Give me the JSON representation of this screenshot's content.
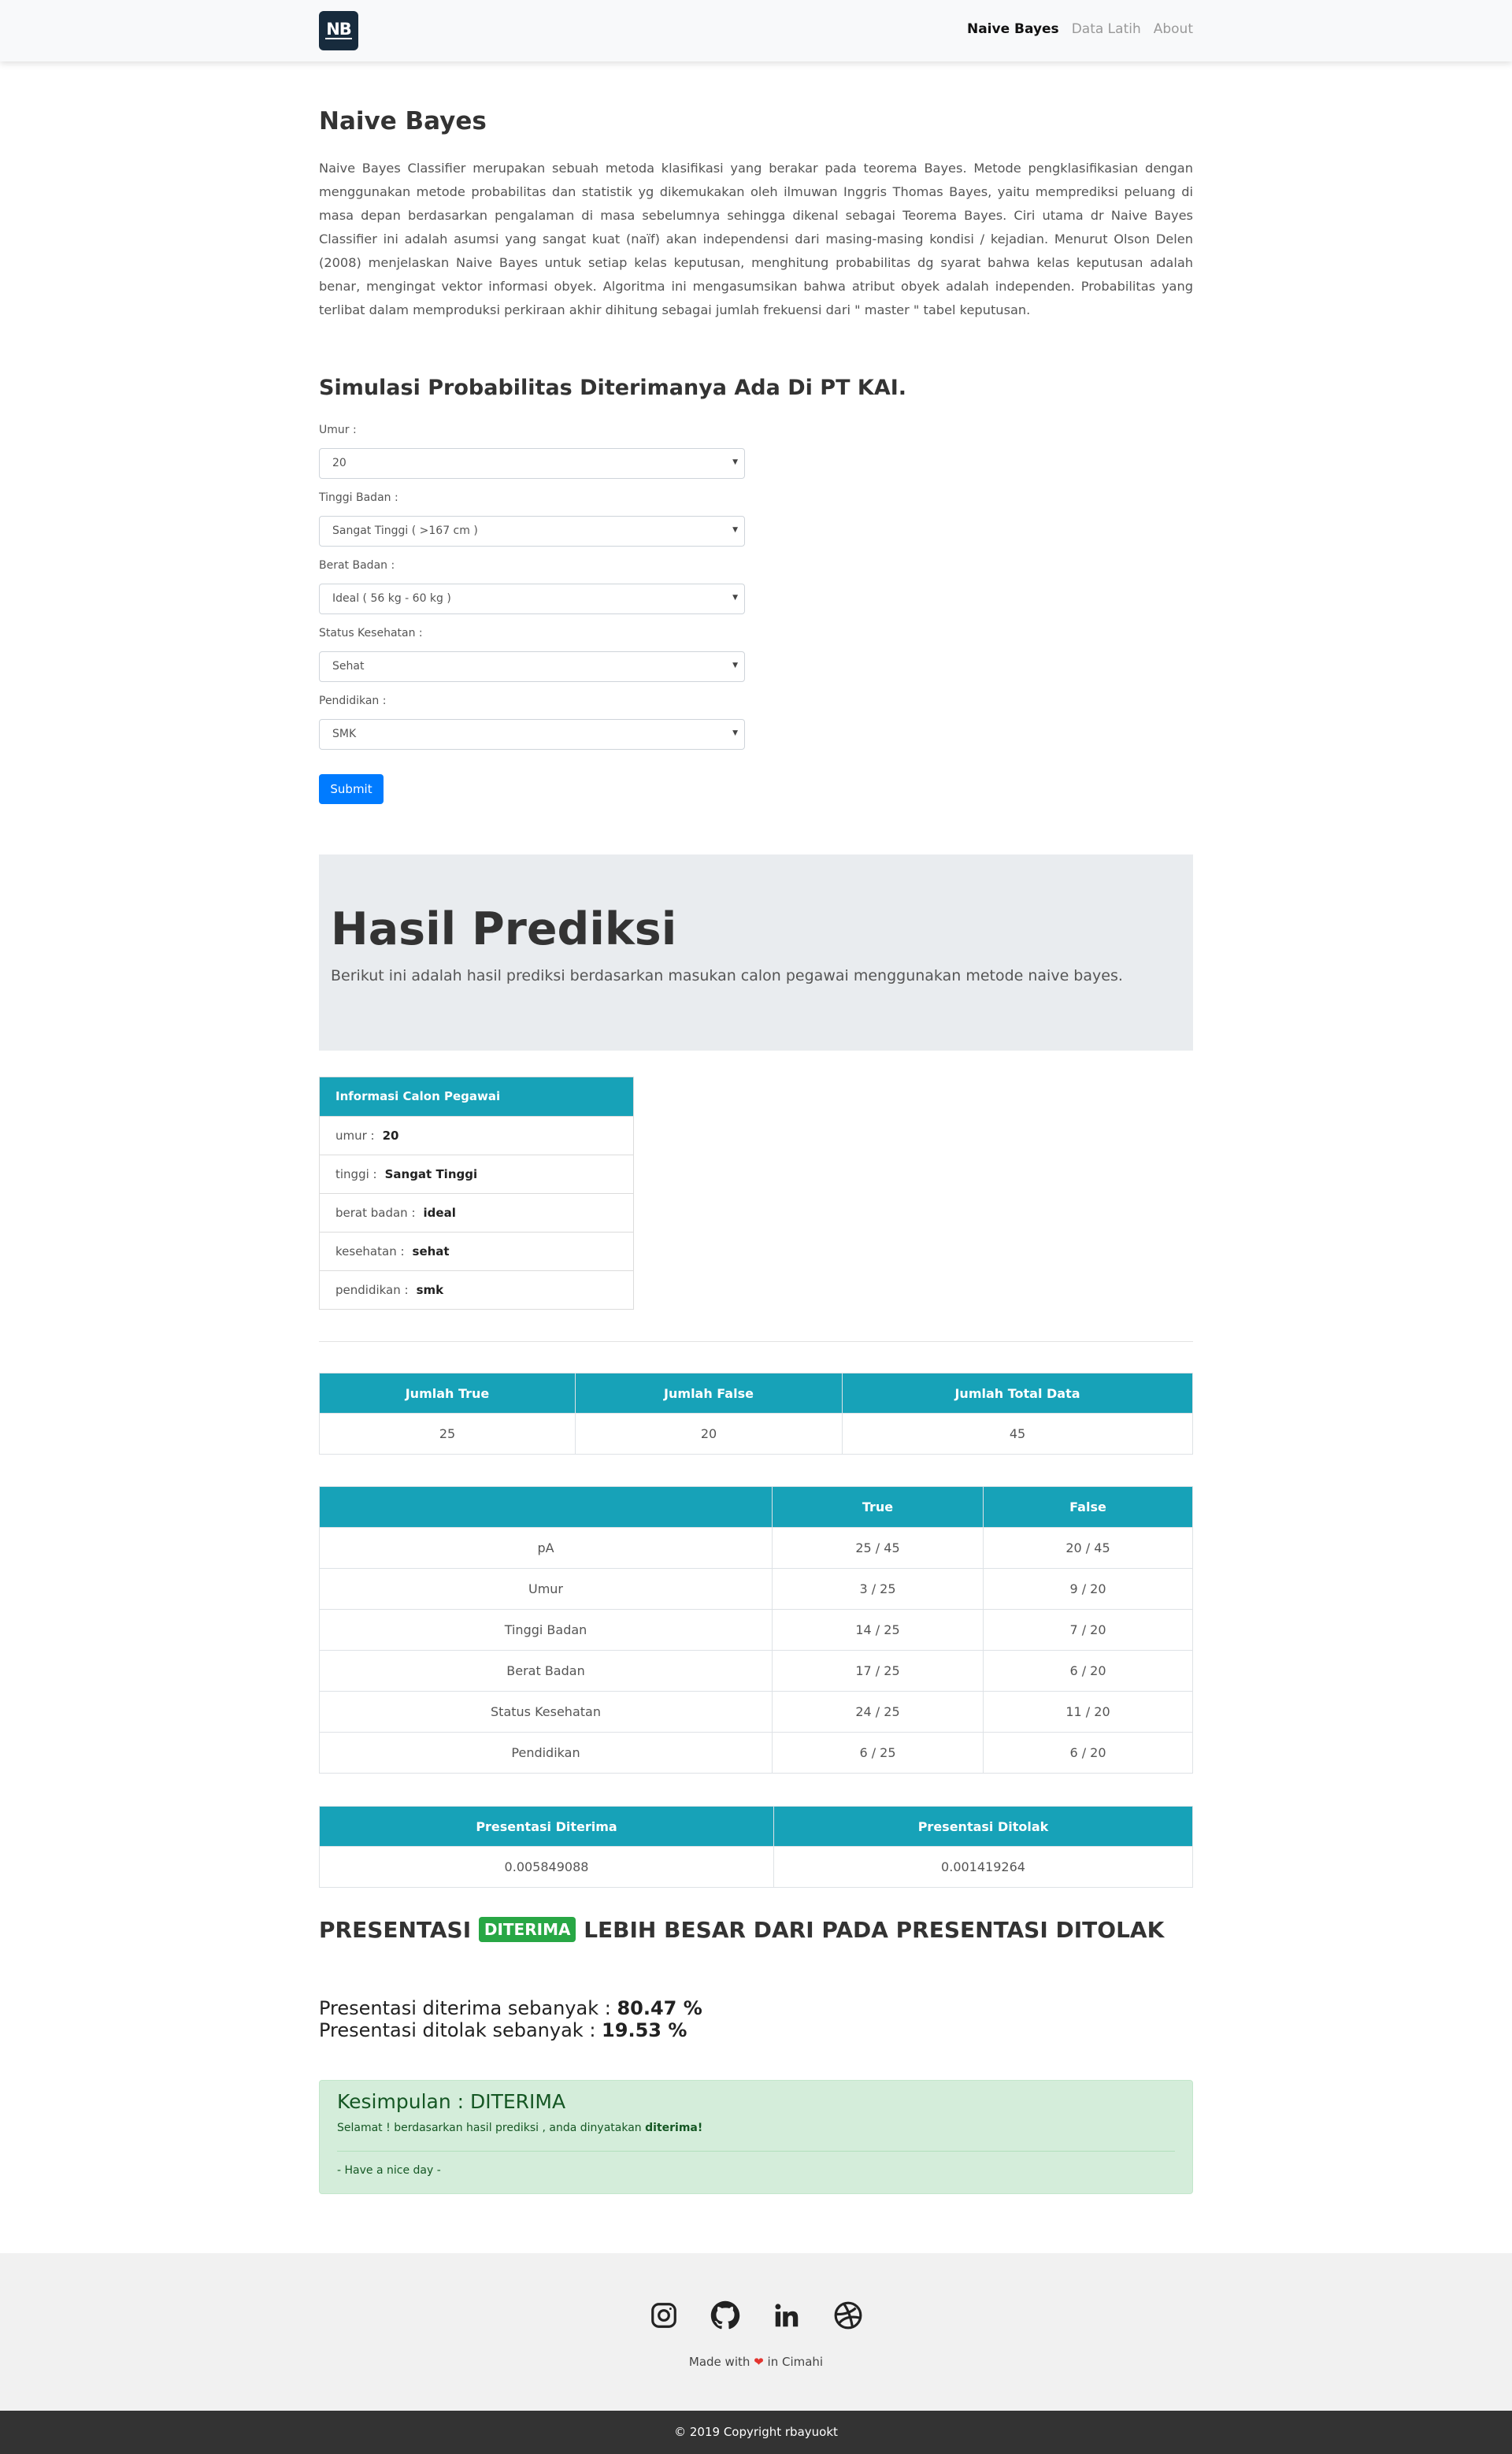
{
  "nav": {
    "brand": "NB",
    "links": [
      {
        "label": "Naive Bayes",
        "active": true
      },
      {
        "label": "Data Latih",
        "active": false
      },
      {
        "label": "About",
        "active": false
      }
    ]
  },
  "intro": {
    "title": "Naive Bayes",
    "paragraph": "Naive Bayes Classifier merupakan sebuah metoda klasifikasi yang berakar pada teorema Bayes. Metode pengklasifikasian dengan menggunakan metode probabilitas dan statistik yg dikemukakan oleh ilmuwan Inggris Thomas Bayes, yaitu memprediksi peluang di masa depan berdasarkan pengalaman di masa sebelumnya sehingga dikenal sebagai Teorema Bayes. Ciri utama dr Naive Bayes Classifier ini adalah asumsi yang sangat kuat (naïf) akan independensi dari masing-masing kondisi / kejadian. Menurut Olson Delen (2008) menjelaskan Naive Bayes untuk setiap kelas keputusan, menghitung probabilitas dg syarat bahwa kelas keputusan adalah benar, mengingat vektor informasi obyek. Algoritma ini mengasumsikan bahwa atribut obyek adalah independen. Probabilitas yang terlibat dalam memproduksi perkiraan akhir dihitung sebagai jumlah frekuensi dari \" master \" tabel keputusan."
  },
  "form": {
    "title": "Simulasi Probabilitas Diterimanya Ada Di PT KAI.",
    "fields": [
      {
        "label": "Umur :",
        "value": "20"
      },
      {
        "label": "Tinggi Badan :",
        "value": "Sangat Tinggi ( >167 cm )"
      },
      {
        "label": "Berat Badan :",
        "value": "Ideal ( 56 kg - 60 kg )"
      },
      {
        "label": "Status Kesehatan :",
        "value": "Sehat"
      },
      {
        "label": "Pendidikan :",
        "value": "SMK"
      }
    ],
    "submit_label": "Submit"
  },
  "hasil": {
    "title": "Hasil Prediksi",
    "subtitle": "Berikut ini adalah hasil prediksi berdasarkan masukan calon pegawai menggunakan metode naive bayes."
  },
  "info": {
    "header": "Informasi Calon Pegawai",
    "rows": [
      {
        "label": "umur :",
        "value": "20"
      },
      {
        "label": "tinggi :",
        "value": "Sangat Tinggi"
      },
      {
        "label": "berat badan :",
        "value": "ideal"
      },
      {
        "label": "kesehatan :",
        "value": "sehat"
      },
      {
        "label": "pendidikan :",
        "value": "smk"
      }
    ]
  },
  "counts": {
    "headers": [
      "Jumlah True",
      "Jumlah False",
      "Jumlah Total Data"
    ],
    "values": [
      "25",
      "20",
      "45"
    ]
  },
  "probs": {
    "headers": [
      "",
      "True",
      "False"
    ],
    "rows": [
      [
        "pA",
        "25 / 45",
        "20 / 45"
      ],
      [
        "Umur",
        "3 / 25",
        "9 / 20"
      ],
      [
        "Tinggi Badan",
        "14 / 25",
        "7 / 20"
      ],
      [
        "Berat Badan",
        "17 / 25",
        "6 / 20"
      ],
      [
        "Status Kesehatan",
        "24 / 25",
        "11 / 20"
      ],
      [
        "Pendidikan",
        "6 / 25",
        "6 / 20"
      ]
    ]
  },
  "presentasi": {
    "headers": [
      "Presentasi Diterima",
      "Presentasi Ditolak"
    ],
    "values": [
      "0.005849088",
      "0.001419264"
    ]
  },
  "verdict": {
    "prefix": "PRESENTASI",
    "badge": "DITERIMA",
    "suffix": "LEBIH BESAR DARI PADA PRESENTASI DITOLAK"
  },
  "percentages": {
    "diterima_label": "Presentasi diterima sebanyak :",
    "diterima_value": "80.47 %",
    "ditolak_label": "Presentasi ditolak sebanyak :",
    "ditolak_value": "19.53 %"
  },
  "kesimpulan": {
    "title": "Kesimpulan : DITERIMA",
    "message": "Selamat ! berdasarkan hasil prediksi , anda dinyatakan",
    "message_bold": "diterima!",
    "footer": "- Have a nice day -"
  },
  "footer": {
    "icons": [
      "instagram-icon",
      "github-icon",
      "linkedin-icon",
      "dribbble-icon"
    ],
    "made_prefix": "Made with",
    "made_suffix": "in Cimahi",
    "copyright": "© 2019 Copyright rbayuokt"
  },
  "colors": {
    "primary": "#007bff",
    "info": "#17a2b8",
    "success": "#28a745",
    "navbar_brand": "#172b3d"
  }
}
